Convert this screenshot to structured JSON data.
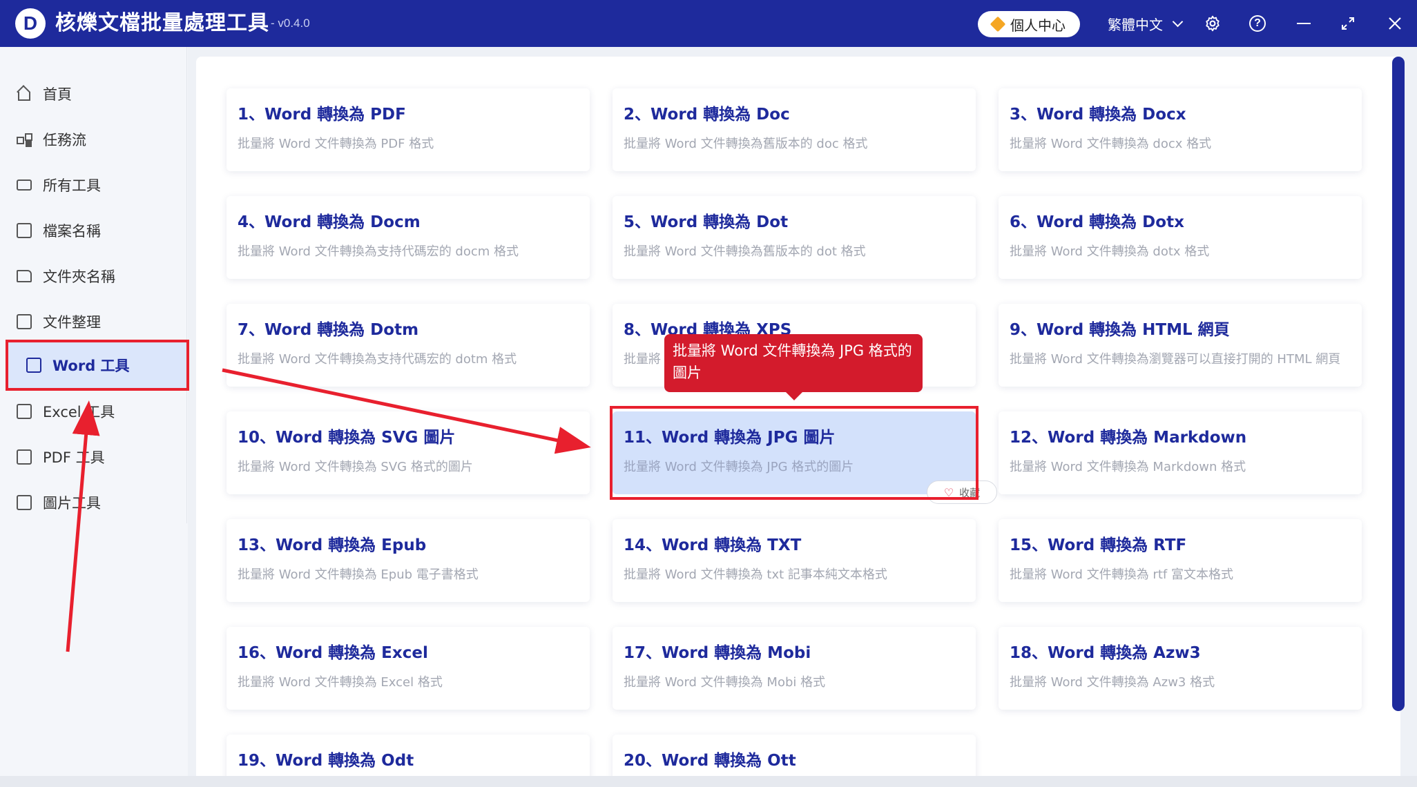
{
  "app": {
    "logo_letter": "D",
    "title": "核爍文檔批量處理工具",
    "version": "- v0.4.0",
    "vip_label": "個人中心",
    "language": "繁體中文"
  },
  "sidebar": {
    "items": [
      {
        "label": "首頁",
        "icon": "home-icon"
      },
      {
        "label": "任務流",
        "icon": "workflow-icon"
      },
      {
        "label": "所有工具",
        "icon": "monitor-icon"
      },
      {
        "label": "檔案名稱",
        "icon": "file-name-icon"
      },
      {
        "label": "文件夾名稱",
        "icon": "folder-icon"
      },
      {
        "label": "文件整理",
        "icon": "organize-icon"
      },
      {
        "label": "Word 工具",
        "icon": "word-file-icon"
      },
      {
        "label": "Excel 工具",
        "icon": "excel-file-icon"
      },
      {
        "label": "PDF 工具",
        "icon": "pdf-file-icon"
      },
      {
        "label": "圖片工具",
        "icon": "image-icon"
      }
    ],
    "active_index": 6
  },
  "tools": [
    {
      "title": "1、Word 轉換為 PDF",
      "desc": "批量將 Word 文件轉換為 PDF 格式"
    },
    {
      "title": "2、Word 轉換為 Doc",
      "desc": "批量將 Word 文件轉換為舊版本的 doc 格式"
    },
    {
      "title": "3、Word 轉換為 Docx",
      "desc": "批量將 Word 文件轉換為 docx 格式"
    },
    {
      "title": "4、Word 轉換為 Docm",
      "desc": "批量將 Word 文件轉換為支持代碼宏的 docm 格式"
    },
    {
      "title": "5、Word 轉換為 Dot",
      "desc": "批量將 Word 文件轉換為舊版本的 dot 格式"
    },
    {
      "title": "6、Word 轉換為 Dotx",
      "desc": "批量將 Word 文件轉換為 dotx 格式"
    },
    {
      "title": "7、Word 轉換為 Dotm",
      "desc": "批量將 Word 文件轉換為支持代碼宏的 dotm 格式"
    },
    {
      "title": "8、Word 轉換為 XPS",
      "desc": "批量將"
    },
    {
      "title": "9、Word 轉換為 HTML 網頁",
      "desc": "批量將 Word 文件轉換為瀏覽器可以直接打開的 HTML 網頁"
    },
    {
      "title": "10、Word 轉換為 SVG 圖片",
      "desc": "批量將 Word 文件轉換為 SVG 格式的圖片"
    },
    {
      "title": "11、Word 轉換為 JPG 圖片",
      "desc": "批量將 Word 文件轉換為 JPG 格式的圖片"
    },
    {
      "title": "12、Word 轉換為 Markdown",
      "desc": "批量將 Word 文件轉換為 Markdown 格式"
    },
    {
      "title": "13、Word 轉換為 Epub",
      "desc": "批量將 Word 文件轉換為 Epub 電子書格式"
    },
    {
      "title": "14、Word 轉換為 TXT",
      "desc": "批量將 Word 文件轉換為 txt 記事本純文本格式"
    },
    {
      "title": "15、Word 轉換為 RTF",
      "desc": "批量將 Word 文件轉換為 rtf 富文本格式"
    },
    {
      "title": "16、Word 轉換為 Excel",
      "desc": "批量將 Word 文件轉換為 Excel 格式"
    },
    {
      "title": "17、Word 轉換為 Mobi",
      "desc": "批量將 Word 文件轉換為 Mobi 格式"
    },
    {
      "title": "18、Word 轉換為 Azw3",
      "desc": "批量將 Word 文件轉換為 Azw3 格式"
    },
    {
      "title": "19、Word 轉換為 Odt",
      "desc": ""
    },
    {
      "title": "20、Word 轉換為 Ott",
      "desc": ""
    }
  ],
  "hovered_tool_index": 10,
  "favorite_label": "收藏",
  "tooltip": {
    "text": "批量將 Word 文件轉換為 JPG 格式的圖片"
  },
  "colors": {
    "accent": "#1e2a9c",
    "annotation_red": "#e8202e",
    "tooltip_red": "#d31b2c",
    "hover_bg": "#d3e1fb"
  }
}
